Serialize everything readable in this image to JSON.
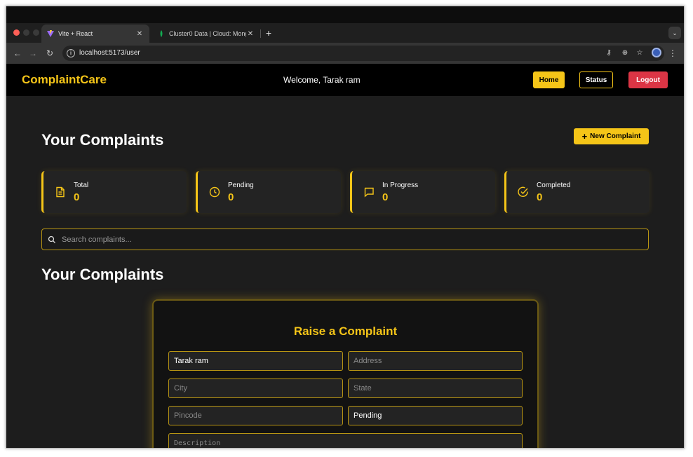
{
  "browser": {
    "tabs": [
      {
        "title": "Vite + React",
        "active": true
      },
      {
        "title": "Cluster0 Data | Cloud: Mongo",
        "active": false
      }
    ],
    "url": "localhost:5173/user"
  },
  "nav": {
    "brand": "ComplaintCare",
    "welcome": "Welcome, Tarak ram",
    "home_label": "Home",
    "status_label": "Status",
    "logout_label": "Logout"
  },
  "page": {
    "title": "Your Complaints",
    "new_complaint_label": "New Complaint",
    "section_title": "Your Complaints"
  },
  "stats": [
    {
      "label": "Total",
      "value": "0",
      "icon": "file-icon"
    },
    {
      "label": "Pending",
      "value": "0",
      "icon": "clock-icon"
    },
    {
      "label": "In Progress",
      "value": "0",
      "icon": "message-icon"
    },
    {
      "label": "Completed",
      "value": "0",
      "icon": "check-circle-icon"
    }
  ],
  "search": {
    "placeholder": "Search complaints..."
  },
  "form": {
    "title": "Raise a Complaint",
    "name_value": "Tarak ram",
    "address_placeholder": "Address",
    "city_placeholder": "City",
    "state_placeholder": "State",
    "pincode_placeholder": "Pincode",
    "status_value": "Pending",
    "description_placeholder": "Description"
  },
  "colors": {
    "accent": "#f5c518",
    "danger": "#dc3545",
    "background": "#1d1d1d"
  }
}
